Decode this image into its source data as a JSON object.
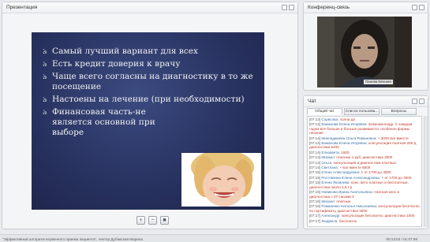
{
  "presentation": {
    "title": "Презентация",
    "bullets": [
      "Самый лучший вариант для всех",
      "Есть кредит доверия к врачу",
      "Чаще всего согласны на диагностику в то же посещение",
      "Настоены на лечение (при необходимости)",
      "Финансовая часть-не является основной при выборе"
    ]
  },
  "conference": {
    "title": "Конференц-связь",
    "participant_name": "Панова Евгения"
  },
  "chat": {
    "title": "Чат",
    "tabs": [
      "Общий чат",
      "Список пользова...",
      "Вопросы"
    ],
    "messages": [
      {
        "time": "[07:13]",
        "name": "Сорвсова:",
        "text": "полна да"
      },
      {
        "time": "[07:14]",
        "name": "Бажанова Елена Игоревна:",
        "text": "возможноподр. С каждым годом всё больше и больше развивается, особенно формы лечения"
      },
      {
        "time": "[07:14]",
        "name": "Миннаджиева Ольга Романовна:",
        "text": "+ 3000 все вместе"
      },
      {
        "time": "[07:14]",
        "name": "Бажанова Елена Игоревна:",
        "text": "консультация платная 250 р, диагностика 5400"
      },
      {
        "time": "[07:14]",
        "name": "Елизавета:",
        "text": "1500"
      },
      {
        "time": "[07:14]",
        "name": "Михаил:",
        "text": "платные 1 руб, диагностика 3000"
      },
      {
        "time": "[07:14]",
        "name": "Ольга:",
        "text": "консультация и диагностика платные"
      },
      {
        "time": "[07:14]",
        "name": "Светлана:",
        "text": "+ все вместе 6000"
      },
      {
        "time": "[07:15]",
        "name": "Елена Александровна:",
        "text": "1 от 1700 до 3000"
      },
      {
        "time": "[07:15]",
        "name": "Ростовкина Елена Александровна:",
        "text": "+ от 1700 до 3000"
      },
      {
        "time": "[07:15]",
        "name": "Елена Яковлева:",
        "text": "конс. вето платные и бесплатные, диагностика около 4,5 т.р"
      },
      {
        "time": "[07:15]",
        "name": "Новикова Ирина Анатольевна:",
        "text": "платная конс и диагностика с 07 снизим 3"
      },
      {
        "time": "[07:16]",
        "name": "Михаил:",
        "text": "платные"
      },
      {
        "time": "[07:16]",
        "name": "Романенко Наталья Николаевна:",
        "text": "консультация бесплатно по сертификату, диагностика 3000"
      },
      {
        "time": "[07:17]",
        "name": "Александр:",
        "text": "консультация бесплатно, диагностика 1500"
      },
      {
        "time": "[07:17]",
        "name": "Людмила:",
        "text": "бесплатно"
      }
    ]
  },
  "status": {
    "left": "\"Эффективный алгоритм первичного приема пациента\", лектор Дубовская Марина",
    "right": "00:13:02 / 01:07:55"
  }
}
